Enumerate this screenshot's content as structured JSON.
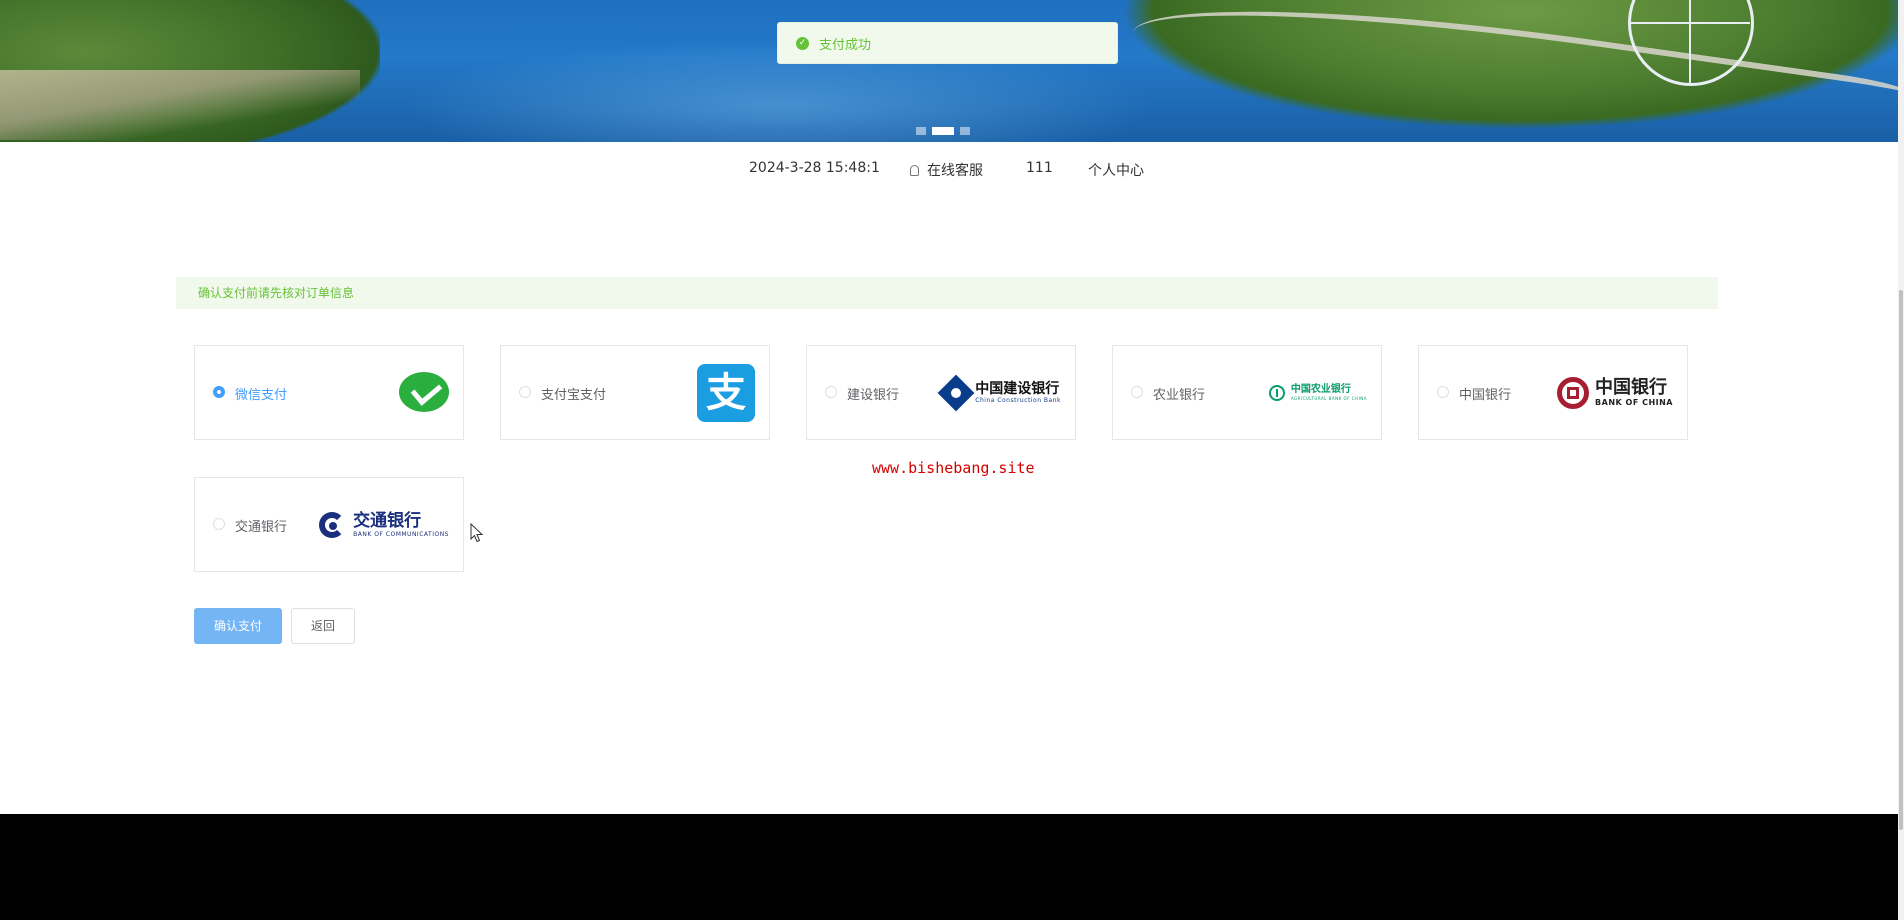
{
  "toast": {
    "message": "支付成功",
    "icon": "check-circle-icon",
    "color": "#67c23a"
  },
  "carousel": {
    "slide_count": 3,
    "active_index": 1
  },
  "topbar": {
    "datetime": "2024-3-28 15:48:1",
    "service_label": "在线客服",
    "service_icon": "user-icon",
    "username": "111",
    "profile_label": "个人中心"
  },
  "notice": {
    "text": "确认支付前请先核对订单信息"
  },
  "payment": {
    "selected": "wechat",
    "methods": [
      {
        "id": "wechat",
        "label": "微信支付",
        "logo": "wechat-pay-logo"
      },
      {
        "id": "alipay",
        "label": "支付宝支付",
        "logo": "alipay-logo",
        "logo_text": "支"
      },
      {
        "id": "ccb",
        "label": "建设银行",
        "logo": "ccb-logo",
        "logo_cn": "中国建设银行",
        "logo_en": "China Construction Bank"
      },
      {
        "id": "abc",
        "label": "农业银行",
        "logo": "abc-logo",
        "logo_cn": "中国农业银行",
        "logo_en": "AGRICULTURAL BANK OF CHINA"
      },
      {
        "id": "boc",
        "label": "中国银行",
        "logo": "boc-logo",
        "logo_cn": "中国银行",
        "logo_en": "BANK OF CHINA"
      },
      {
        "id": "bocom",
        "label": "交通银行",
        "logo": "bocom-logo",
        "logo_cn": "交通银行",
        "logo_en": "BANK OF COMMUNICATIONS"
      }
    ]
  },
  "watermark": "www.bishebang.site",
  "actions": {
    "confirm_label": "确认支付",
    "back_label": "返回"
  },
  "colors": {
    "accent": "#409eff",
    "success": "#67c23a",
    "footer": "#000000"
  }
}
